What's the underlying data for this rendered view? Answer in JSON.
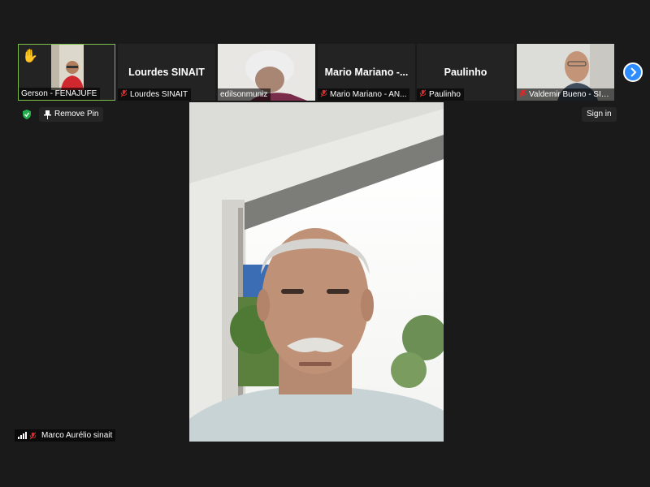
{
  "participants": [
    {
      "name": "Gerson - FENAJUFE",
      "video": true,
      "hand_raised": true,
      "muted": false,
      "active": true
    },
    {
      "name": "Lourdes SINAIT",
      "display_name": "Lourdes SINAIT",
      "video": false,
      "muted": true
    },
    {
      "name": "edilsonmuniz",
      "video": true,
      "muted": false
    },
    {
      "name": "Mario Mariano - AN...",
      "display_name": "Mario Mariano -...",
      "video": false,
      "muted": true
    },
    {
      "name": "Paulinho",
      "display_name": "Paulinho",
      "video": false,
      "muted": true
    },
    {
      "name": "Valdemir Bueno - SIN...",
      "video": true,
      "muted": true
    }
  ],
  "controls": {
    "remove_pin_label": "Remove Pin",
    "sign_in_label": "Sign in"
  },
  "main_speaker": {
    "name": "Marco Aurélio sinait",
    "muted": true
  },
  "colors": {
    "background": "#1a1a1a",
    "tile": "#232323",
    "active_border": "#7cc04a",
    "accent": "#2d8cff",
    "muted": "#e02828"
  }
}
